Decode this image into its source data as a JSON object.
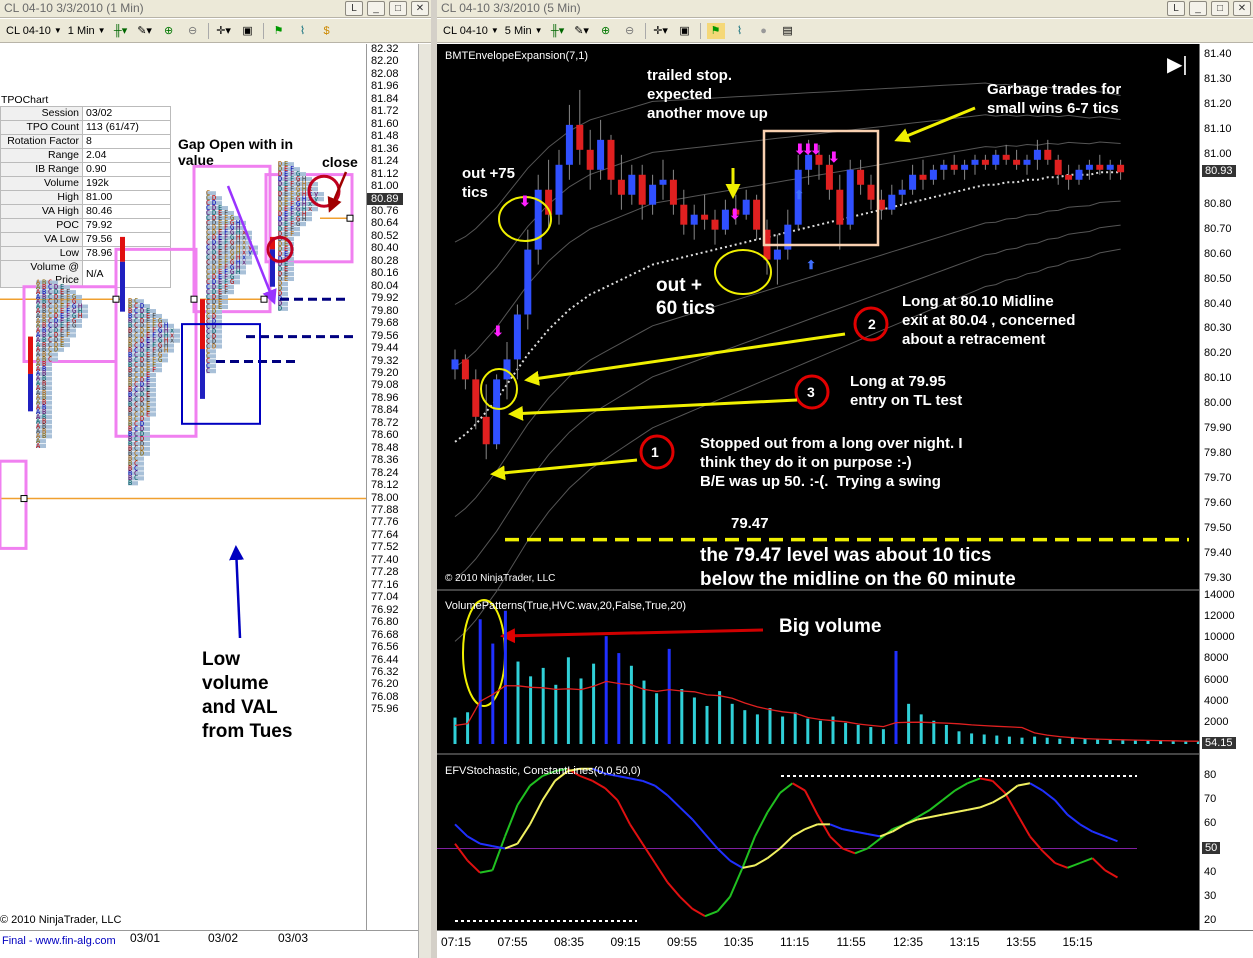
{
  "left_window": {
    "title": "CL 04-10  3/3/2010 (1 Min)",
    "instrument": "CL 04-10",
    "interval": "1 Min",
    "tpo_chart_label": "TPOChart",
    "stats": [
      {
        "k": "Session",
        "v": "03/02"
      },
      {
        "k": "TPO Count",
        "v": "113 (61/47)"
      },
      {
        "k": "Rotation Factor",
        "v": "8"
      },
      {
        "k": "Range",
        "v": "2.04"
      },
      {
        "k": "IB Range",
        "v": "0.90"
      },
      {
        "k": "Volume",
        "v": "192k"
      },
      {
        "k": "High",
        "v": "81.00"
      },
      {
        "k": "VA High",
        "v": "80.46"
      },
      {
        "k": "POC",
        "v": "79.92"
      },
      {
        "k": "VA Low",
        "v": "79.56"
      },
      {
        "k": "Low",
        "v": "78.96"
      },
      {
        "k": "Volume @ Price",
        "v": "N/A"
      }
    ],
    "price_axis": [
      "82.32",
      "82.20",
      "82.08",
      "81.96",
      "81.84",
      "81.72",
      "81.60",
      "81.48",
      "81.36",
      "81.24",
      "81.12",
      "81.00",
      "80.89",
      "80.76",
      "80.64",
      "80.52",
      "80.40",
      "80.28",
      "80.16",
      "80.04",
      "79.92",
      "79.80",
      "79.68",
      "79.56",
      "79.44",
      "79.32",
      "79.20",
      "79.08",
      "78.96",
      "78.84",
      "78.72",
      "78.60",
      "78.48",
      "78.36",
      "78.24",
      "78.12",
      "78.00",
      "77.88",
      "77.76",
      "77.64",
      "77.52",
      "77.40",
      "77.28",
      "77.16",
      "77.04",
      "76.92",
      "76.80",
      "76.68",
      "76.56",
      "76.44",
      "76.32",
      "76.20",
      "76.08",
      "75.96"
    ],
    "current_price": "80.89",
    "dates": [
      "03/01",
      "03/02",
      "03/03"
    ],
    "copyright": "© 2010 NinjaTrader, LLC",
    "footer_link": "Final - www.fin-alg.com",
    "annotations": {
      "gap_open": "Gap Open with in\nvalue",
      "close": "close",
      "low_volume": "Low\nvolume\nand VAL\nfrom Tues"
    }
  },
  "right_window": {
    "title": "CL 04-10  3/3/2010 (5 Min)",
    "instrument": "CL 04-10",
    "interval": "5 Min",
    "price_indicator": "BMTEnvelopeExpansion(7,1)",
    "volume_indicator": "VolumePatterns(True,HVC.wav,20,False,True,20)",
    "stoch_indicator": "EFVStochastic, ConstantLines(0,0,50,0)",
    "copyright": "© 2010 NinjaTrader, LLC",
    "price_axis": [
      "81.40",
      "81.30",
      "81.20",
      "81.10",
      "81.00",
      "80.93",
      "80.80",
      "80.70",
      "80.60",
      "80.50",
      "80.40",
      "80.30",
      "80.20",
      "80.10",
      "80.00",
      "79.90",
      "79.80",
      "79.70",
      "79.60",
      "79.50",
      "79.40",
      "79.30"
    ],
    "current_price": "80.93",
    "volume_axis": [
      "14000",
      "12000",
      "10000",
      "8000",
      "6000",
      "4000",
      "2000"
    ],
    "current_volume": "54.15",
    "stoch_axis": [
      "80",
      "70",
      "60",
      "50",
      "40",
      "30",
      "20"
    ],
    "current_stoch": "50",
    "times": [
      "07:15",
      "07:55",
      "08:35",
      "09:15",
      "09:55",
      "10:35",
      "11:15",
      "11:55",
      "12:35",
      "13:15",
      "13:55",
      "15:15"
    ],
    "annotations": {
      "trailed_stop": "trailed stop.\nexpected\nanother move up",
      "garbage": "Garbage trades for\nsmall wins 6-7 tics",
      "out75": "out +75\ntics",
      "out60": "out +\n60 tics",
      "long_midline": "Long at 80.10 Midline\nexit at 80.04 , concerned\nabout a retracement",
      "long_tl": "Long at 79.95\nentry on TL test",
      "stopped": "Stopped out from a long over night. I\nthink they do it on purpose :-)\nB/E was up 50. :-(.  Trying a swing",
      "level": "79.47",
      "level_note": "the 79.47 level was about 10 tics\nbelow the midline on the 60 minute",
      "big_volume": "Big volume",
      "n1": "1",
      "n2": "2",
      "n3": "3"
    },
    "candles": [
      [
        80.14,
        80.22,
        80.1,
        80.18
      ],
      [
        80.18,
        80.2,
        80.06,
        80.1
      ],
      [
        80.1,
        80.14,
        79.9,
        79.95
      ],
      [
        79.95,
        80.08,
        79.78,
        79.84
      ],
      [
        79.84,
        80.12,
        79.82,
        80.1
      ],
      [
        80.1,
        80.25,
        80.02,
        80.18
      ],
      [
        80.18,
        80.4,
        80.1,
        80.36
      ],
      [
        80.36,
        80.7,
        80.3,
        80.62
      ],
      [
        80.62,
        80.92,
        80.56,
        80.86
      ],
      [
        80.86,
        80.98,
        80.7,
        80.76
      ],
      [
        80.76,
        81.02,
        80.72,
        80.96
      ],
      [
        80.96,
        81.2,
        80.9,
        81.12
      ],
      [
        81.12,
        81.26,
        80.96,
        81.02
      ],
      [
        81.02,
        81.1,
        80.86,
        80.94
      ],
      [
        80.94,
        81.14,
        80.9,
        81.06
      ],
      [
        81.06,
        81.08,
        80.84,
        80.9
      ],
      [
        80.9,
        81.0,
        80.78,
        80.84
      ],
      [
        80.84,
        80.96,
        80.8,
        80.92
      ],
      [
        80.92,
        80.96,
        80.74,
        80.8
      ],
      [
        80.8,
        80.92,
        80.76,
        80.88
      ],
      [
        80.88,
        80.98,
        80.82,
        80.9
      ],
      [
        80.9,
        80.94,
        80.76,
        80.8
      ],
      [
        80.8,
        80.86,
        80.68,
        80.72
      ],
      [
        80.72,
        80.8,
        80.66,
        80.76
      ],
      [
        80.76,
        80.84,
        80.7,
        80.74
      ],
      [
        80.74,
        80.78,
        80.64,
        80.7
      ],
      [
        80.7,
        80.82,
        80.68,
        80.78
      ],
      [
        80.78,
        80.84,
        80.72,
        80.76
      ],
      [
        80.76,
        80.86,
        80.74,
        80.82
      ],
      [
        80.82,
        80.84,
        80.66,
        80.7
      ],
      [
        80.7,
        80.74,
        80.52,
        80.58
      ],
      [
        80.58,
        80.68,
        80.48,
        80.62
      ],
      [
        80.62,
        80.78,
        80.58,
        80.72
      ],
      [
        80.72,
        81.0,
        80.7,
        80.94
      ],
      [
        80.94,
        81.06,
        80.88,
        81.0
      ],
      [
        81.0,
        81.04,
        80.9,
        80.96
      ],
      [
        80.96,
        81.0,
        80.82,
        80.86
      ],
      [
        80.86,
        80.92,
        80.62,
        80.72
      ],
      [
        80.72,
        80.98,
        80.7,
        80.94
      ],
      [
        80.94,
        80.98,
        80.84,
        80.88
      ],
      [
        80.88,
        80.92,
        80.78,
        80.82
      ],
      [
        80.82,
        80.86,
        80.74,
        80.78
      ],
      [
        80.78,
        80.88,
        80.76,
        80.84
      ],
      [
        80.84,
        80.9,
        80.8,
        80.86
      ],
      [
        80.86,
        80.96,
        80.84,
        80.92
      ],
      [
        80.92,
        80.98,
        80.86,
        80.9
      ],
      [
        80.9,
        80.96,
        80.88,
        80.94
      ],
      [
        80.94,
        80.98,
        80.9,
        80.96
      ],
      [
        80.96,
        81.0,
        80.92,
        80.94
      ],
      [
        80.94,
        80.98,
        80.9,
        80.96
      ],
      [
        80.96,
        81.0,
        80.92,
        80.98
      ],
      [
        80.98,
        81.0,
        80.94,
        80.96
      ],
      [
        80.96,
        81.02,
        80.94,
        81.0
      ],
      [
        81.0,
        81.04,
        80.96,
        80.98
      ],
      [
        80.98,
        81.02,
        80.94,
        80.96
      ],
      [
        80.96,
        81.0,
        80.92,
        80.98
      ],
      [
        80.98,
        81.06,
        80.94,
        81.02
      ],
      [
        81.02,
        81.06,
        80.96,
        80.98
      ],
      [
        80.98,
        81.0,
        80.88,
        80.92
      ],
      [
        80.92,
        80.96,
        80.86,
        80.9
      ],
      [
        80.9,
        80.96,
        80.88,
        80.94
      ],
      [
        80.94,
        80.98,
        80.9,
        80.96
      ],
      [
        80.96,
        81.0,
        80.92,
        80.94
      ],
      [
        80.94,
        80.98,
        80.9,
        80.96
      ],
      [
        80.96,
        80.98,
        80.9,
        80.93
      ]
    ],
    "volumes": [
      2500,
      3000,
      11800,
      9500,
      12600,
      7800,
      6400,
      7200,
      5600,
      8200,
      6200,
      7600,
      10200,
      8600,
      7400,
      6000,
      4800,
      9000,
      5200,
      4400,
      3600,
      5000,
      3800,
      3200,
      2800,
      3400,
      2600,
      3000,
      2400,
      2200,
      2600,
      2000,
      1800,
      1600,
      1400,
      8800,
      3800,
      2800,
      2200,
      1800,
      1200,
      1000,
      900,
      800,
      700,
      600,
      700,
      600,
      500,
      600,
      500,
      450,
      400,
      380,
      350,
      320,
      300,
      300,
      280,
      260
    ],
    "stoch_fast": [
      52,
      45,
      40,
      41,
      55,
      68,
      76,
      80,
      82,
      83,
      80,
      78,
      75,
      70,
      60,
      52,
      44,
      36,
      30,
      25,
      22,
      24,
      30,
      42,
      55,
      65,
      73,
      77,
      74,
      64,
      55,
      50,
      48,
      50,
      54,
      58,
      60,
      63,
      66,
      70,
      74,
      77,
      79,
      78,
      73,
      64,
      55,
      49,
      44,
      42,
      44,
      46,
      41,
      38
    ],
    "stoch_slow": [
      60,
      55,
      52,
      51,
      50,
      52,
      60,
      70,
      78,
      82,
      83,
      83,
      81,
      80,
      79,
      78,
      76,
      72,
      67,
      62,
      56,
      50,
      45,
      42,
      43,
      46,
      50,
      55,
      58,
      60,
      60,
      58,
      57,
      56,
      55,
      57,
      60,
      62,
      63,
      64,
      65,
      66,
      67,
      69,
      72,
      76,
      77,
      74,
      70,
      64,
      60,
      57,
      55,
      53
    ],
    "envelope_mid": [
      79.85,
      79.88,
      79.92,
      79.97,
      80.02,
      80.08,
      80.14,
      80.2,
      80.25,
      80.3,
      80.34,
      80.38,
      80.41,
      80.44,
      80.46,
      80.48,
      80.5,
      80.52,
      80.54,
      80.56,
      80.57,
      80.58,
      80.59,
      80.6,
      80.61,
      80.62,
      80.63,
      80.64,
      80.65,
      80.66,
      80.67,
      80.68,
      80.69,
      80.7,
      80.71,
      80.72,
      80.73,
      80.74,
      80.75,
      80.76,
      80.77,
      80.78,
      80.79,
      80.8,
      80.81,
      80.82,
      80.83,
      80.84,
      80.85,
      80.86,
      80.87,
      80.88,
      80.88,
      80.89,
      80.89,
      80.9,
      80.9,
      80.91,
      80.91,
      80.92,
      80.92,
      80.92,
      80.93,
      80.93,
      80.93
    ]
  }
}
